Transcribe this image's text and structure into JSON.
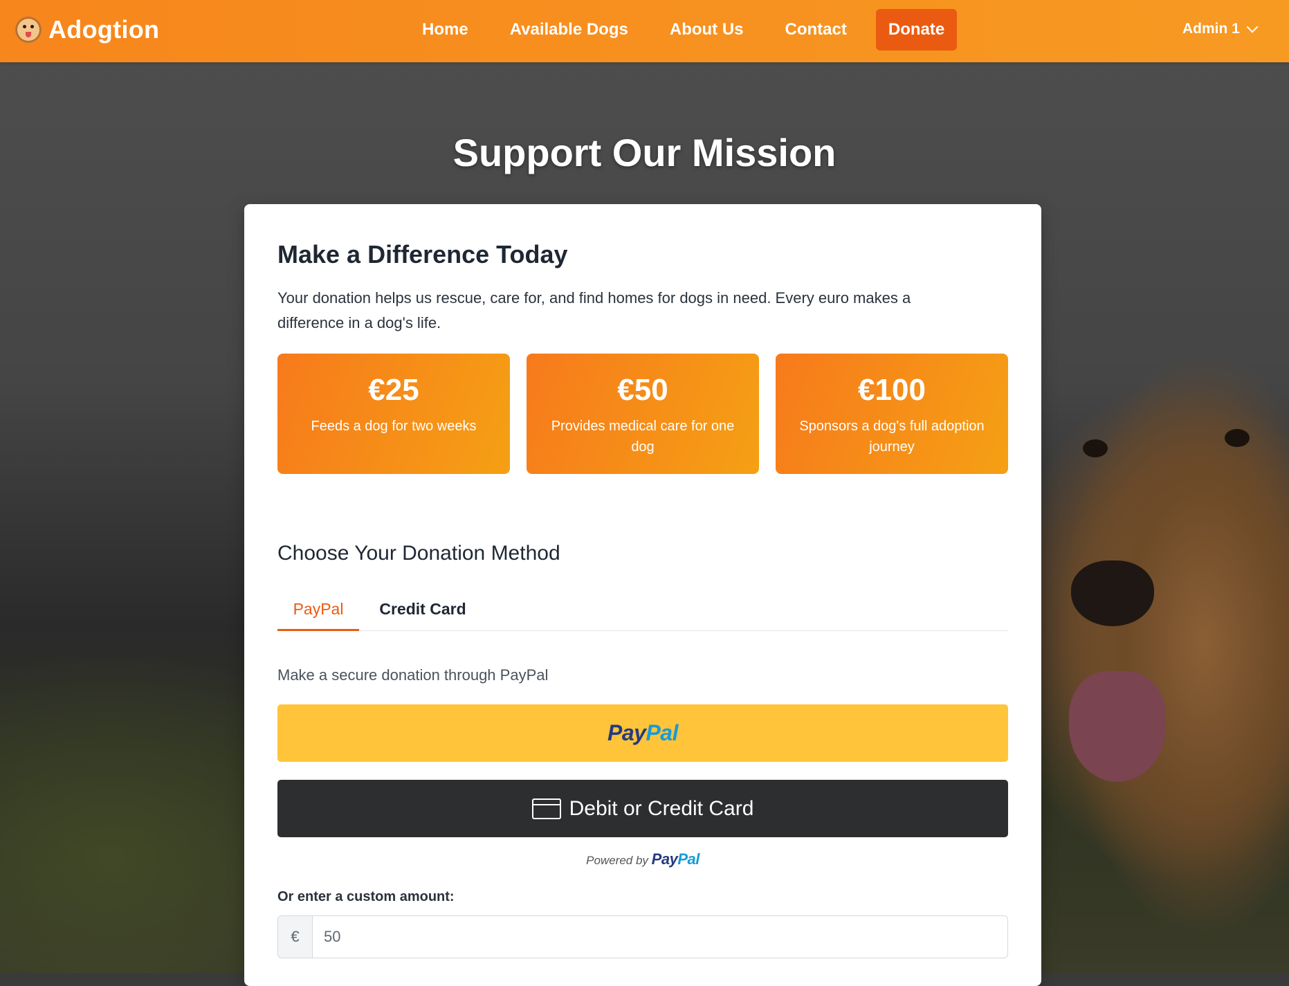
{
  "nav": {
    "brand": "Adogtion",
    "brand_icon": "dog-face-icon",
    "links": [
      "Home",
      "Available Dogs",
      "About Us",
      "Contact",
      "Donate"
    ],
    "active": "Donate",
    "user": "Admin 1",
    "accent": "#f7861c",
    "donate_bg": "#ea5b11"
  },
  "hero": {
    "title": "Support Our Mission"
  },
  "card": {
    "title": "Make a Difference Today",
    "description": "Your donation helps us rescue, care for, and find homes for dogs in need. Every euro makes a difference in a dog's life.",
    "tiers": [
      {
        "amount": "€25",
        "description": "Feeds a dog for two weeks"
      },
      {
        "amount": "€50",
        "description": "Provides medical care for one dog"
      },
      {
        "amount": "€100",
        "description": "Sponsors a dog's full adoption journey"
      }
    ],
    "method_title": "Choose Your Donation Method",
    "tabs": [
      "PayPal",
      "Credit Card"
    ],
    "active_tab": "PayPal",
    "secure_text": "Make a secure donation through PayPal",
    "paypal_button": {
      "logo_a": "Pay",
      "logo_b": "Pal",
      "bg": "#ffc439"
    },
    "card_button": {
      "label": "Debit or Credit Card",
      "icon": "credit-card-icon",
      "bg": "#2c2e2f"
    },
    "powered_by": {
      "prefix": "Powered by",
      "logo_a": "Pay",
      "logo_b": "Pal"
    },
    "custom_amount": {
      "label": "Or enter a custom amount:",
      "currency": "€",
      "value": "50"
    }
  }
}
